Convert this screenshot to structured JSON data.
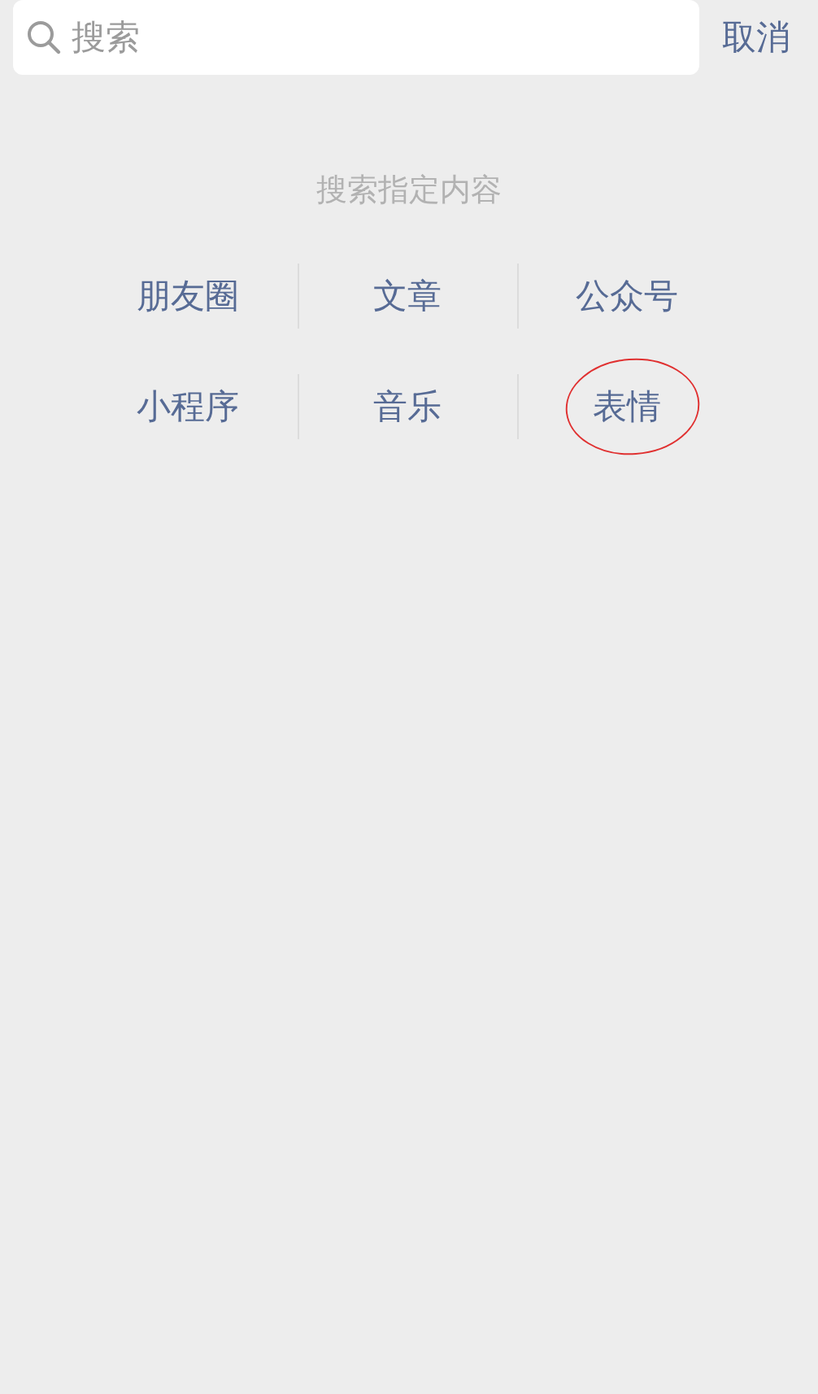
{
  "search": {
    "placeholder": "搜索"
  },
  "cancel": "取消",
  "section_title": "搜索指定内容",
  "categories": [
    {
      "label": "朋友圈",
      "circled": false
    },
    {
      "label": "文章",
      "circled": false
    },
    {
      "label": "公众号",
      "circled": false
    },
    {
      "label": "小程序",
      "circled": false
    },
    {
      "label": "音乐",
      "circled": false
    },
    {
      "label": "表情",
      "circled": true
    }
  ]
}
